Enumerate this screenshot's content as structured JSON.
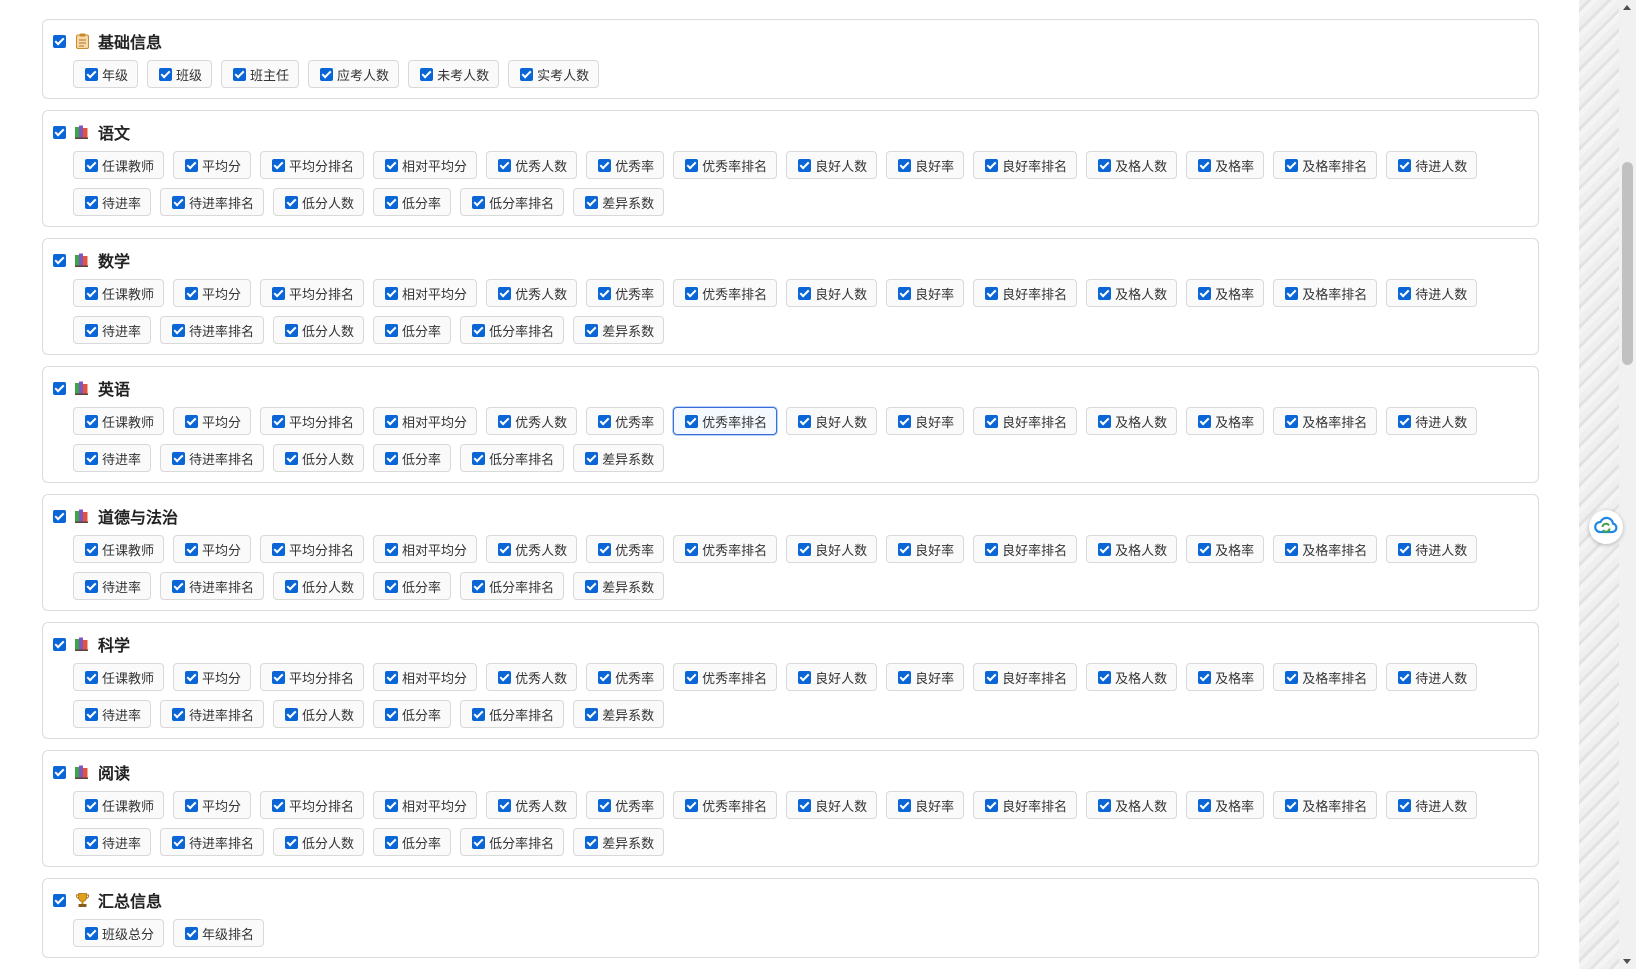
{
  "sections": [
    {
      "title": "基础信息",
      "icon": "clipboard-icon",
      "rows": [
        [
          "年级",
          "班级",
          "班主任",
          "应考人数",
          "未考人数",
          "实考人数"
        ]
      ]
    },
    {
      "title": "语文",
      "icon": "books-icon",
      "rows": [
        [
          "任课教师",
          "平均分",
          "平均分排名",
          "相对平均分",
          "优秀人数",
          "优秀率",
          "优秀率排名",
          "良好人数",
          "良好率",
          "良好率排名",
          "及格人数",
          "及格率",
          "及格率排名",
          "待进人数"
        ],
        [
          "待进率",
          "待进率排名",
          "低分人数",
          "低分率",
          "低分率排名",
          "差异系数"
        ]
      ]
    },
    {
      "title": "数学",
      "icon": "books-icon",
      "rows": [
        [
          "任课教师",
          "平均分",
          "平均分排名",
          "相对平均分",
          "优秀人数",
          "优秀率",
          "优秀率排名",
          "良好人数",
          "良好率",
          "良好率排名",
          "及格人数",
          "及格率",
          "及格率排名",
          "待进人数"
        ],
        [
          "待进率",
          "待进率排名",
          "低分人数",
          "低分率",
          "低分率排名",
          "差异系数"
        ]
      ]
    },
    {
      "title": "英语",
      "icon": "books-icon",
      "rows": [
        [
          "任课教师",
          "平均分",
          "平均分排名",
          "相对平均分",
          "优秀人数",
          "优秀率",
          "优秀率排名",
          "良好人数",
          "良好率",
          "良好率排名",
          "及格人数",
          "及格率",
          "及格率排名",
          "待进人数"
        ],
        [
          "待进率",
          "待进率排名",
          "低分人数",
          "低分率",
          "低分率排名",
          "差异系数"
        ]
      ]
    },
    {
      "title": "道德与法治",
      "icon": "books-icon",
      "rows": [
        [
          "任课教师",
          "平均分",
          "平均分排名",
          "相对平均分",
          "优秀人数",
          "优秀率",
          "优秀率排名",
          "良好人数",
          "良好率",
          "良好率排名",
          "及格人数",
          "及格率",
          "及格率排名",
          "待进人数"
        ],
        [
          "待进率",
          "待进率排名",
          "低分人数",
          "低分率",
          "低分率排名",
          "差异系数"
        ]
      ]
    },
    {
      "title": "科学",
      "icon": "books-icon",
      "rows": [
        [
          "任课教师",
          "平均分",
          "平均分排名",
          "相对平均分",
          "优秀人数",
          "优秀率",
          "优秀率排名",
          "良好人数",
          "良好率",
          "良好率排名",
          "及格人数",
          "及格率",
          "及格率排名",
          "待进人数"
        ],
        [
          "待进率",
          "待进率排名",
          "低分人数",
          "低分率",
          "低分率排名",
          "差异系数"
        ]
      ]
    },
    {
      "title": "阅读",
      "icon": "books-icon",
      "rows": [
        [
          "任课教师",
          "平均分",
          "平均分排名",
          "相对平均分",
          "优秀人数",
          "优秀率",
          "优秀率排名",
          "良好人数",
          "良好率",
          "良好率排名",
          "及格人数",
          "及格率",
          "及格率排名",
          "待进人数"
        ],
        [
          "待进率",
          "待进率排名",
          "低分人数",
          "低分率",
          "低分率排名",
          "差异系数"
        ]
      ]
    },
    {
      "title": "汇总信息",
      "icon": "trophy-icon",
      "rows": [
        [
          "班级总分",
          "年级排名"
        ]
      ]
    }
  ],
  "focused": {
    "section": 3,
    "row": 0,
    "item": 6
  },
  "all_checked": true,
  "colors": {
    "checkbox": "#0a66d6",
    "focus_border": "#3a6fd8"
  },
  "floating_button_icon": "cloud-sync-icon"
}
